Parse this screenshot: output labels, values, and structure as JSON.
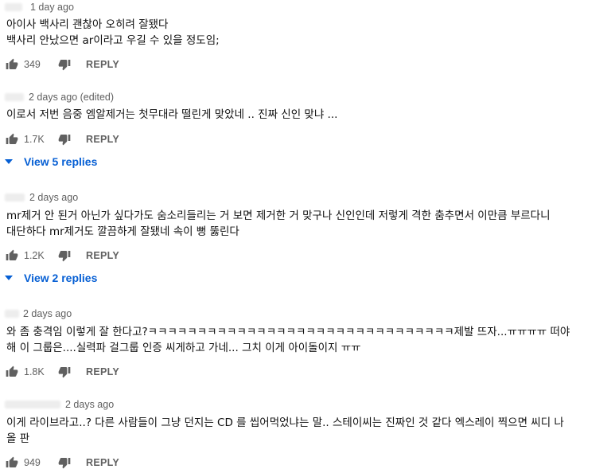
{
  "reply_label": "REPLY",
  "comments": [
    {
      "time": "1 day ago",
      "lines": [
        "아이사 백사리 괜찮아 오히려 잘됐다",
        "백사리 안났으면 ar이라고 우길 수 있을 정도임;"
      ],
      "likes": "349"
    },
    {
      "time": "2 days ago (edited)",
      "lines": [
        "이로서 저번 음중 엠알제거는 첫무대라 떨린게 맞았네 .. 진짜 신인 맞냐 ..."
      ],
      "likes": "1.7K",
      "view_replies": "View 5 replies"
    },
    {
      "time": "2 days ago",
      "lines": [
        "mr제거 안 된거 아닌가 싶다가도 숨소리들리는 거 보면 제거한 거 맞구나 신인인데 저렇게 격한 춤추면서 이만큼 부르다니",
        "대단하다 mr제거도 깔끔하게 잘됐네 속이 뻥 뚫린다"
      ],
      "likes": "1.2K",
      "view_replies": "View 2 replies"
    },
    {
      "time": "2 days ago",
      "lines": [
        "와 좀 충격임 이렇게 잘 한다고?ㅋㅋㅋㅋㅋㅋㅋㅋㅋㅋㅋㅋㅋㅋㅋㅋㅋㅋㅋㅋㅋㅋㅋㅋㅋㅋㅋㅋㅋㅋㅋ제발 뜨자...ㅠㅠㅠㅠ 떠야",
        "해 이 그룹은....실력파 걸그룹 인증 씨게하고 가네... 그치 이게 아이돌이지 ㅠㅠ"
      ],
      "likes": "1.8K"
    },
    {
      "time": "2 days ago",
      "lines": [
        "이게 라이브라고..? 다른 사람들이 그냥 던지는 CD 를 씹어먹었냐는 말.. 스테이씨는 진짜인 것 같다 엑스레이 찍으면 씨디 나",
        "올 판"
      ],
      "likes": "949"
    }
  ]
}
